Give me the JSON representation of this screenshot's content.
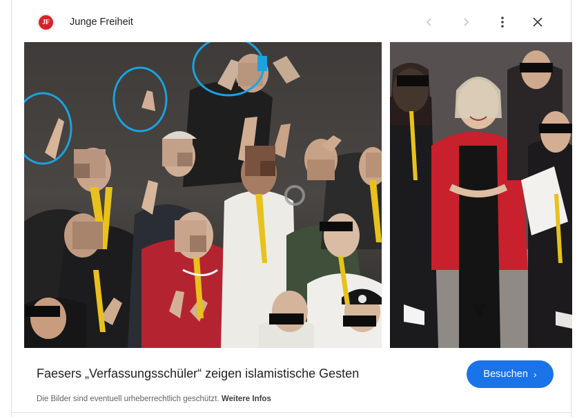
{
  "header": {
    "logo_text": "JF",
    "logo_color": "#d6222b",
    "site_name": "Junge Freiheit",
    "icons": [
      "chevron-left-icon",
      "chevron-right-icon",
      "more-vert-icon",
      "close-icon"
    ]
  },
  "images": {
    "main_colors": {
      "wall": "#3a3836",
      "lanyard": "#e8c21a",
      "circle": "#1aa3e0",
      "redacted": "#0c0c0c"
    },
    "side_colors": {
      "jacket": "#c8202c",
      "lanyard": "#e8c21a",
      "redacted": "#0c0c0c"
    }
  },
  "caption": {
    "title": "Faesers „Verfassungsschüler“ zeigen islamistische Gesten",
    "visit_label": "Besuchen",
    "visit_icon": "chevron-right-icon",
    "accent": "#1a73e8"
  },
  "footer": {
    "notice": "Die Bilder sind eventuell urheberrechtlich geschützt.",
    "more_info": "Weitere Infos"
  }
}
